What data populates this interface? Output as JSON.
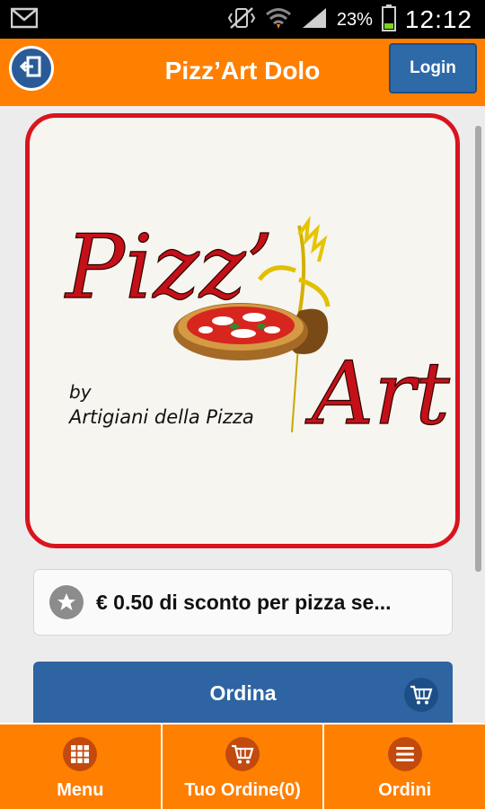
{
  "status_bar": {
    "battery_percent": "23%",
    "time": "12:12"
  },
  "header": {
    "title": "Pizz’Art Dolo",
    "login_label": "Login"
  },
  "logo": {
    "brand_text_top": "Pizz’",
    "brand_text_bottom": "Art",
    "tagline_by": "by",
    "tagline": "Artigiani della Pizza"
  },
  "promo": {
    "text": "€ 0.50 di sconto per pizza se..."
  },
  "order": {
    "label": "Ordina"
  },
  "bottom_nav": {
    "items": [
      {
        "label": "Menu",
        "icon": "grid-icon"
      },
      {
        "label": "Tuo Ordine(0)",
        "icon": "cart-icon"
      },
      {
        "label": "Ordini",
        "icon": "list-icon"
      }
    ]
  },
  "colors": {
    "header_orange": "#ff7f00",
    "button_blue": "#2e64a2",
    "logo_border_red": "#d9141e"
  }
}
